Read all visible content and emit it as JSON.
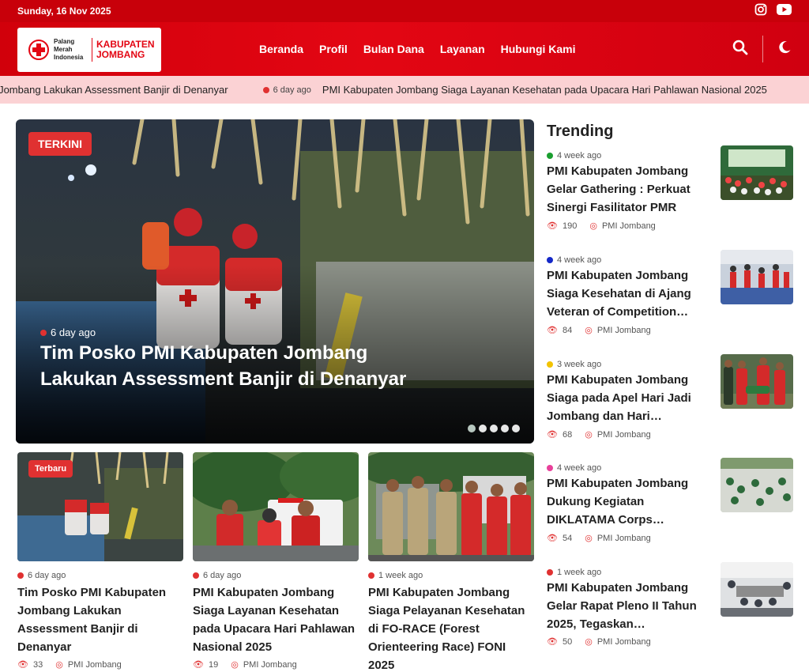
{
  "topbar": {
    "date": "Sunday, 16 Nov 2025",
    "social_icons": [
      "instagram-icon",
      "youtube-icon"
    ]
  },
  "brand": {
    "line1": "Palang",
    "line2": "Merah",
    "line3": "Indonesia",
    "kab1": "KABUPATEN",
    "kab2": "JOMBANG"
  },
  "nav": {
    "items": [
      "Beranda",
      "Profil",
      "Bulan Dana",
      "Layanan",
      "Hubungi Kami"
    ]
  },
  "header_icons": [
    "search-icon",
    "moon-icon"
  ],
  "ticker": {
    "items": [
      {
        "time": "",
        "text": "en Jombang Lakukan Assessment Banjir di Denanyar"
      },
      {
        "time": "6 day ago",
        "text": "PMI Kabupaten Jombang Siaga Layanan Kesehatan pada Upacara Hari Pahlawan Nasional 2025"
      }
    ]
  },
  "hero": {
    "badge": "TERKINI",
    "time": "6 day ago",
    "title": "Tim Posko PMI Kabupaten Jombang Lakukan Assessment Banjir di Denanyar",
    "slides": 5,
    "active_slide": 0
  },
  "cards": [
    {
      "badge": "Terbaru",
      "time": "6 day ago",
      "title": "Tim Posko PMI Kabupaten Jombang Lakukan Assessment Banjir di Denanyar",
      "views": "33",
      "author": "PMI Jombang"
    },
    {
      "badge": "",
      "time": "6 day ago",
      "title": "PMI Kabupaten Jombang Siaga Layanan Kesehatan pada Upacara Hari Pahlawan Nasional 2025",
      "views": "19",
      "author": "PMI Jombang"
    },
    {
      "badge": "",
      "time": "1 week ago",
      "title": "PMI Kabupaten Jombang Siaga Pelayanan Kesehatan di FO-RACE (Forest Orienteering Race) FONI 2025",
      "views": "",
      "author": ""
    }
  ],
  "trending": {
    "heading": "Trending",
    "items": [
      {
        "time": "4 week ago",
        "dot": "#1a9e2f",
        "title": "PMI Kabupaten Jombang Gelar Gathering : Perkuat Sinergi Fasilitator PMR",
        "views": "190",
        "author": "PMI Jombang"
      },
      {
        "time": "4 week ago",
        "dot": "#1428c8",
        "title": "PMI Kabupaten Jombang Siaga Kesehatan di Ajang Veteran of Competition…",
        "views": "84",
        "author": "PMI Jombang"
      },
      {
        "time": "3 week ago",
        "dot": "#f2c300",
        "title": "PMI Kabupaten Jombang Siaga pada Apel Hari Jadi Jombang dan Hari…",
        "views": "68",
        "author": "PMI Jombang"
      },
      {
        "time": "4 week ago",
        "dot": "#e8409a",
        "title": "PMI Kabupaten Jombang Dukung Kegiatan DIKLATAMA Corps…",
        "views": "54",
        "author": "PMI Jombang"
      },
      {
        "time": "1 week ago",
        "dot": "#e03131",
        "title": "PMI Kabupaten Jombang Gelar Rapat Pleno II Tahun 2025, Tegaskan…",
        "views": "50",
        "author": "PMI Jombang"
      }
    ]
  },
  "colors": {
    "brand_red": "#e30613",
    "badge_red": "#e03131",
    "ticker_bg": "#fbd2d4"
  }
}
